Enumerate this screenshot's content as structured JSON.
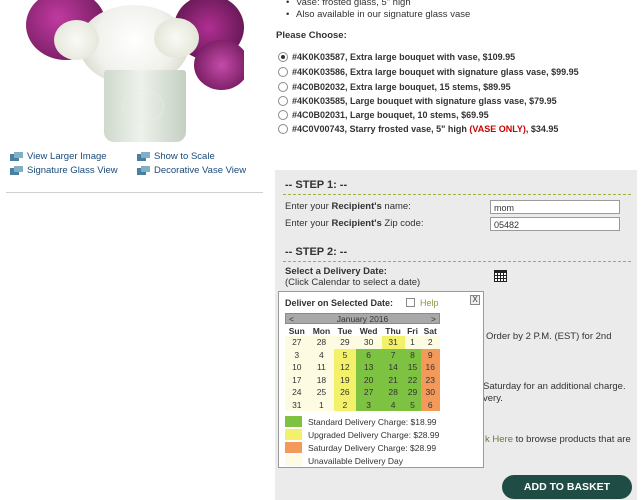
{
  "product_links": [
    {
      "label": "View Larger Image"
    },
    {
      "label": "Show to Scale"
    },
    {
      "label": "Signature Glass View"
    },
    {
      "label": "Decorative Vase View"
    }
  ],
  "details_bullets": [
    "Vase: frosted glass, 5\" high",
    "Also available in our signature glass vase"
  ],
  "please_choose": "Please Choose:",
  "options": [
    {
      "label": "#4K0K03587, Extra large bouquet with vase, $109.95",
      "selected": true
    },
    {
      "label": "#4K0K03586, Extra large bouquet with signature glass vase, $99.95",
      "selected": false
    },
    {
      "label": "#4C0B02032, Extra large bouquet, 15 stems, $89.95",
      "selected": false
    },
    {
      "label": "#4K0K03585, Large bouquet with signature glass vase, $79.95",
      "selected": false
    },
    {
      "label": "#4C0B02031, Large bouquet, 10 stems, $69.95",
      "selected": false
    },
    {
      "label_prefix": "#4C0V00743, Starry frosted vase, 5\" high ",
      "label_red": "(VASE ONLY)",
      "label_suffix": ", $34.95",
      "selected": false
    }
  ],
  "step1": {
    "title": "-- STEP 1: --",
    "name_label_pre": "Enter your ",
    "name_label_bold": "Recipient's",
    "name_label_post": " name:",
    "name_value": "mom",
    "zip_label_pre": "Enter your ",
    "zip_label_bold": "Recipient's",
    "zip_label_post": " Zip code:",
    "zip_value": "05482"
  },
  "step2": {
    "title": "-- STEP 2: --",
    "select_date": "Select a Delivery Date:",
    "click_calendar": "(Click Calendar to select a date)",
    "calendar_icon": "calendar-icon"
  },
  "partial_text": {
    "order_by": "Order by 2 P.M. (EST) for 2nd",
    "saturday": "Saturday for an additional charge.",
    "very": "very.",
    "click_here": "k Here",
    "browse": " to browse products that are"
  },
  "add_to_basket": "ADD TO BASKET",
  "calendar": {
    "header": "Deliver on Selected Date:",
    "help": "Help",
    "close": "X",
    "prev": "<",
    "next": ">",
    "month": "January 2016",
    "weekdays": [
      "Sun",
      "Mon",
      "Tue",
      "Wed",
      "Thu",
      "Fri",
      "Sat"
    ],
    "weeks": [
      [
        {
          "d": "27",
          "t": "un"
        },
        {
          "d": "28",
          "t": "un"
        },
        {
          "d": "29",
          "t": "un"
        },
        {
          "d": "30",
          "t": "un"
        },
        {
          "d": "31",
          "t": "up"
        },
        {
          "d": "1",
          "t": "un"
        },
        {
          "d": "2",
          "t": "un"
        }
      ],
      [
        {
          "d": "3",
          "t": "un"
        },
        {
          "d": "4",
          "t": "un"
        },
        {
          "d": "5",
          "t": "up"
        },
        {
          "d": "6",
          "t": "std"
        },
        {
          "d": "7",
          "t": "std"
        },
        {
          "d": "8",
          "t": "std"
        },
        {
          "d": "9",
          "t": "sat"
        }
      ],
      [
        {
          "d": "10",
          "t": "un"
        },
        {
          "d": "11",
          "t": "un"
        },
        {
          "d": "12",
          "t": "up"
        },
        {
          "d": "13",
          "t": "std"
        },
        {
          "d": "14",
          "t": "std"
        },
        {
          "d": "15",
          "t": "std"
        },
        {
          "d": "16",
          "t": "sat"
        }
      ],
      [
        {
          "d": "17",
          "t": "un"
        },
        {
          "d": "18",
          "t": "un"
        },
        {
          "d": "19",
          "t": "up"
        },
        {
          "d": "20",
          "t": "std"
        },
        {
          "d": "21",
          "t": "std"
        },
        {
          "d": "22",
          "t": "std"
        },
        {
          "d": "23",
          "t": "sat"
        }
      ],
      [
        {
          "d": "24",
          "t": "un"
        },
        {
          "d": "25",
          "t": "un"
        },
        {
          "d": "26",
          "t": "up"
        },
        {
          "d": "27",
          "t": "std"
        },
        {
          "d": "28",
          "t": "std"
        },
        {
          "d": "29",
          "t": "std"
        },
        {
          "d": "30",
          "t": "sat"
        }
      ],
      [
        {
          "d": "31",
          "t": "un"
        },
        {
          "d": "1",
          "t": "un"
        },
        {
          "d": "2",
          "t": "up"
        },
        {
          "d": "3",
          "t": "std"
        },
        {
          "d": "4",
          "t": "std"
        },
        {
          "d": "5",
          "t": "std"
        },
        {
          "d": "6",
          "t": "sat"
        }
      ]
    ],
    "legend": [
      {
        "label": "Standard Delivery Charge: $18.99",
        "type": "std"
      },
      {
        "label": "Upgraded Delivery Charge: $28.99",
        "type": "up"
      },
      {
        "label": "Saturday Delivery Charge: $28.99",
        "type": "sat"
      },
      {
        "label": "Unavailable Delivery Day",
        "type": "un"
      }
    ]
  },
  "colors": {
    "standard": "#7ec242",
    "upgraded": "#f3f06a",
    "saturday": "#f39a5a",
    "unavailable": "#fdfce2",
    "basket": "#1f4d46"
  }
}
